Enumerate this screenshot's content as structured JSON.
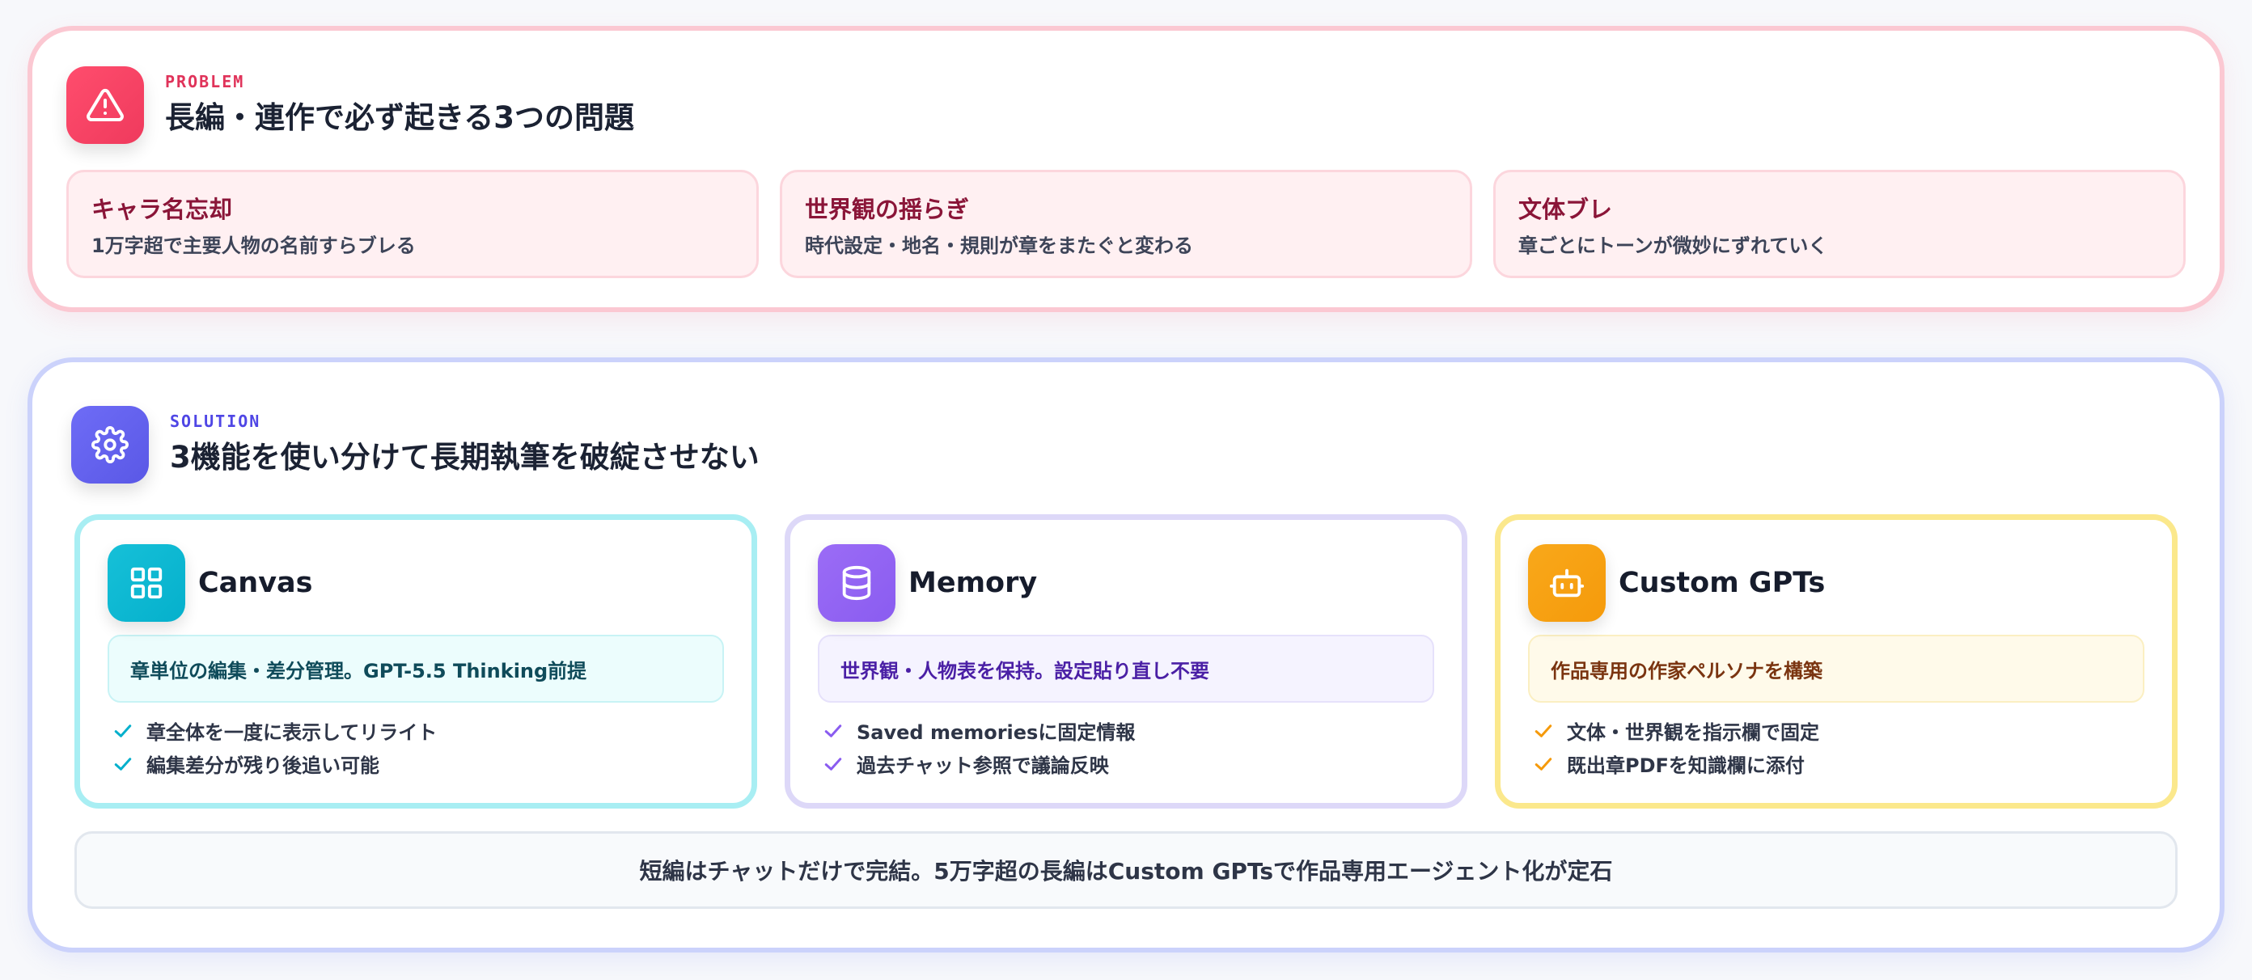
{
  "problem": {
    "eyebrow": "PROBLEM",
    "title": "長編・連作で必ず起きる3つの問題",
    "icon": "warning-icon",
    "accent_color": "#ef3a5d",
    "cards": [
      {
        "title": "キャラ名忘却",
        "desc": "1万字超で主要人物の名前すらブレる"
      },
      {
        "title": "世界観の揺らぎ",
        "desc": "時代設定・地名・規則が章をまたぐと変わる"
      },
      {
        "title": "文体ブレ",
        "desc": "章ごとにトーンが微妙にずれていく"
      }
    ]
  },
  "solution": {
    "eyebrow": "SOLUTION",
    "title": "3機能を使い分けて長期執筆を破綻させない",
    "icon": "gear-icon",
    "accent_color": "#5a58e6",
    "features": [
      {
        "name": "Canvas",
        "icon": "grid-icon",
        "color": "#05b0cc",
        "summary": "章単位の編集・差分管理。GPT-5.5 Thinking前提",
        "points": [
          "章全体を一度に表示してリライト",
          "編集差分が残り後追い可能"
        ]
      },
      {
        "name": "Memory",
        "icon": "database-icon",
        "color": "#8a5cf0",
        "summary": "世界観・人物表を保持。設定貼り直し不要",
        "points": [
          "Saved memoriesに固定情報",
          "過去チャット参照で議論反映"
        ]
      },
      {
        "name": "Custom GPTs",
        "icon": "bot-icon",
        "color": "#f59a0b",
        "summary": "作品専用の作家ペルソナを構築",
        "points": [
          "文体・世界観を指示欄で固定",
          "既出章PDFを知識欄に添付"
        ]
      }
    ],
    "note": "短編はチャットだけで完結。5万字超の長編はCustom GPTsで作品専用エージェント化が定石"
  }
}
